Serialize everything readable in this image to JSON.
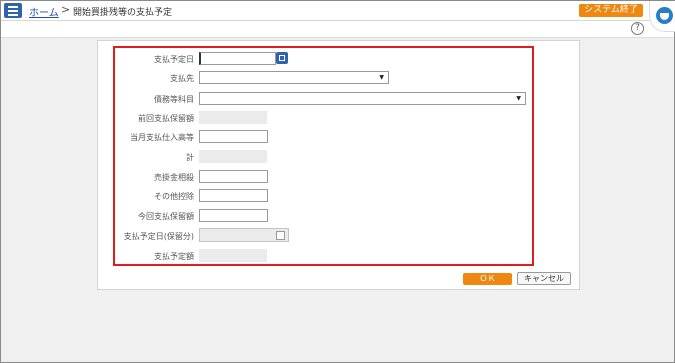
{
  "header": {
    "home_link": "ホーム",
    "separator": ">",
    "page_title": "開始買掛残等の支払予定",
    "exit_button": "システム終了",
    "help": "?"
  },
  "form": {
    "fields": [
      {
        "label": "支払予定日",
        "value": "",
        "kind": "date"
      },
      {
        "label": "支払先",
        "value": "",
        "kind": "select"
      },
      {
        "label": "債務等科目",
        "value": "",
        "kind": "select"
      },
      {
        "label": "前回支払保留額",
        "value": "",
        "kind": "readonly"
      },
      {
        "label": "当月支払仕入高等",
        "value": "",
        "kind": "text"
      },
      {
        "label": "計",
        "value": "",
        "kind": "readonly"
      },
      {
        "label": "売掛金相殺",
        "value": "",
        "kind": "text"
      },
      {
        "label": "その他控除",
        "value": "",
        "kind": "text"
      },
      {
        "label": "今回支払保留額",
        "value": "",
        "kind": "text"
      },
      {
        "label": "支払予定日(保留分)",
        "value": "",
        "kind": "date-disabled"
      },
      {
        "label": "支払予定額",
        "value": "",
        "kind": "readonly"
      }
    ]
  },
  "buttons": {
    "ok": "ＯＫ",
    "cancel": "キャンセル"
  },
  "colors": {
    "accent_orange": "#ee8811",
    "nav_blue": "#2f63ae",
    "highlight_red": "#e01e1e"
  }
}
